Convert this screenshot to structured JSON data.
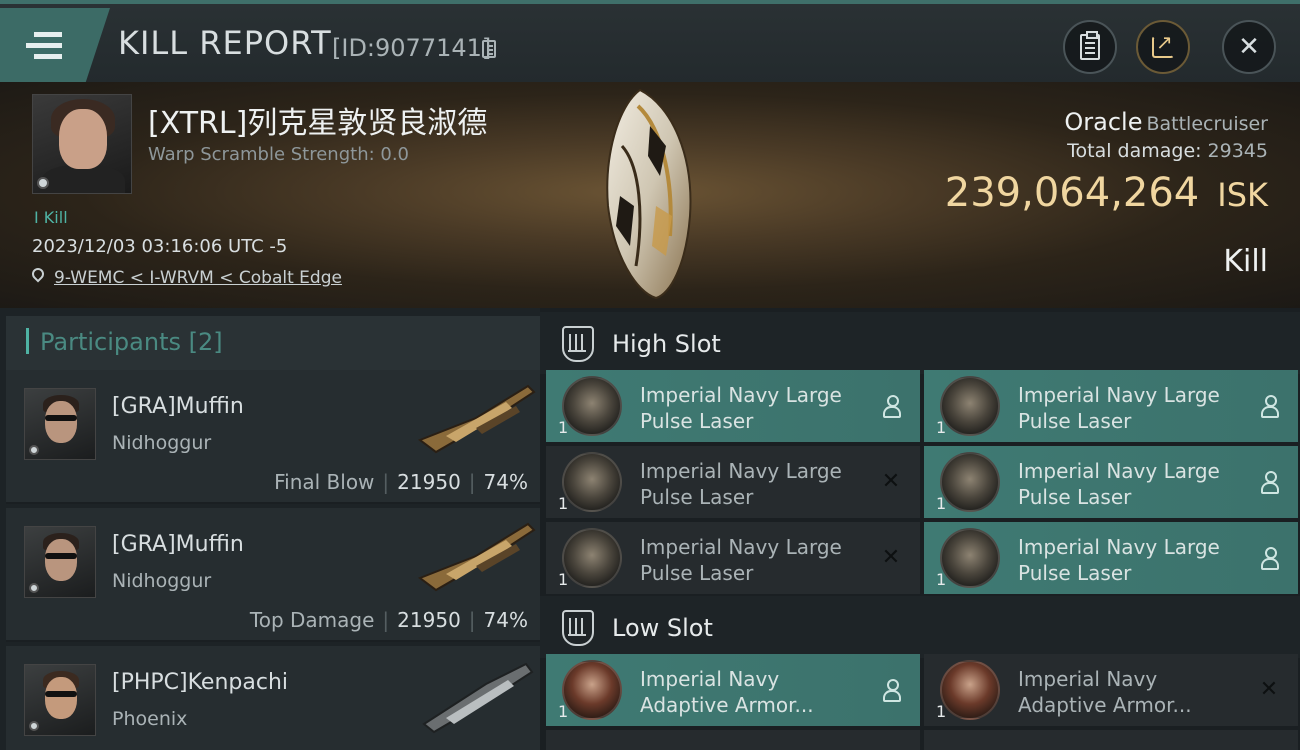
{
  "header": {
    "title": "KILL REPORT",
    "report_id": "[ID:9077141]",
    "close_glyph": "✕"
  },
  "victim": {
    "name": "[XTRL]列克星敦贤良淑德",
    "warp_scramble": "Warp Scramble Strength: 0.0",
    "kill_tag": "I Kill",
    "datetime": "2023/12/03 03:16:06 UTC -5",
    "location": "9-WEMC < I-WRVM < Cobalt Edge",
    "ship_name": "Oracle",
    "ship_class": "Battlecruiser",
    "total_damage_label": "Total damage:",
    "total_damage": "29345",
    "isk_value": "239,064,264",
    "isk_unit": "ISK",
    "outcome": "Kill"
  },
  "participants": {
    "title": "Participants [2]",
    "list": [
      {
        "name": "[GRA]Muffin",
        "ship": "Nidhoggur",
        "label": "Final Blow",
        "damage": "21950",
        "percent": "74%"
      },
      {
        "name": "[GRA]Muffin",
        "ship": "Nidhoggur",
        "label": "Top Damage",
        "damage": "21950",
        "percent": "74%"
      },
      {
        "name": "[PHPC]Kenpachi",
        "ship": "Phoenix"
      }
    ]
  },
  "slots": {
    "high": {
      "title": "High Slot",
      "modules": [
        {
          "qty": "1",
          "name": "Imperial Navy Large Pulse Laser",
          "status": "dropped"
        },
        {
          "qty": "1",
          "name": "Imperial Navy Large Pulse Laser",
          "status": "dropped"
        },
        {
          "qty": "1",
          "name": "Imperial Navy Large Pulse Laser",
          "status": "destroyed"
        },
        {
          "qty": "1",
          "name": "Imperial Navy Large Pulse Laser",
          "status": "dropped"
        },
        {
          "qty": "1",
          "name": "Imperial Navy Large Pulse Laser",
          "status": "destroyed"
        },
        {
          "qty": "1",
          "name": "Imperial Navy Large Pulse Laser",
          "status": "dropped"
        }
      ]
    },
    "low": {
      "title": "Low Slot",
      "modules": [
        {
          "qty": "1",
          "name": "Imperial Navy Adaptive Armor...",
          "status": "dropped"
        },
        {
          "qty": "1",
          "name": "Imperial Navy Adaptive Armor...",
          "status": "destroyed"
        }
      ]
    },
    "status_glyphs": {
      "destroyed": "✕"
    }
  },
  "colors": {
    "accent_teal": "#3f7a73",
    "isk_gold": "#f0d6a0",
    "participants_teal": "#4fb3a4"
  }
}
